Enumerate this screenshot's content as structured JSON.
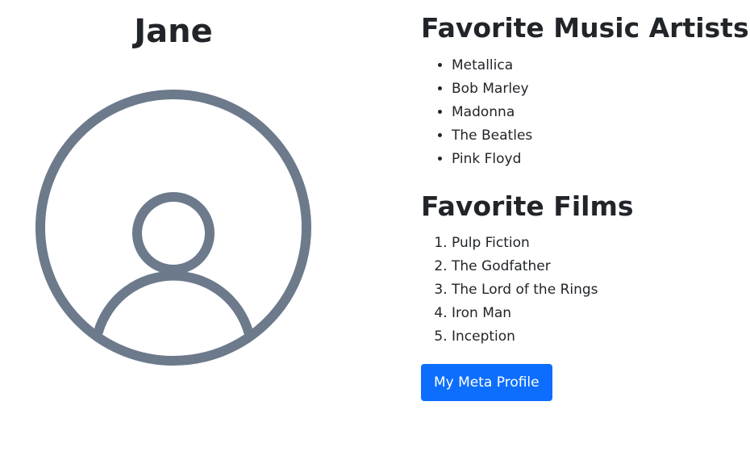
{
  "profile": {
    "name": "Jane",
    "avatar_icon": "user-circle-icon",
    "avatar_color": "#6c7a8b"
  },
  "music": {
    "heading": "Favorite Music Artists",
    "items": [
      "Metallica",
      "Bob Marley",
      "Madonna",
      "The Beatles",
      "Pink Floyd"
    ]
  },
  "films": {
    "heading": "Favorite Films",
    "items": [
      "Pulp Fiction",
      "The Godfather",
      "The Lord of the Rings",
      "Iron Man",
      "Inception"
    ]
  },
  "actions": {
    "meta_profile_label": "My Meta Profile",
    "button_color": "#0d6efd"
  }
}
